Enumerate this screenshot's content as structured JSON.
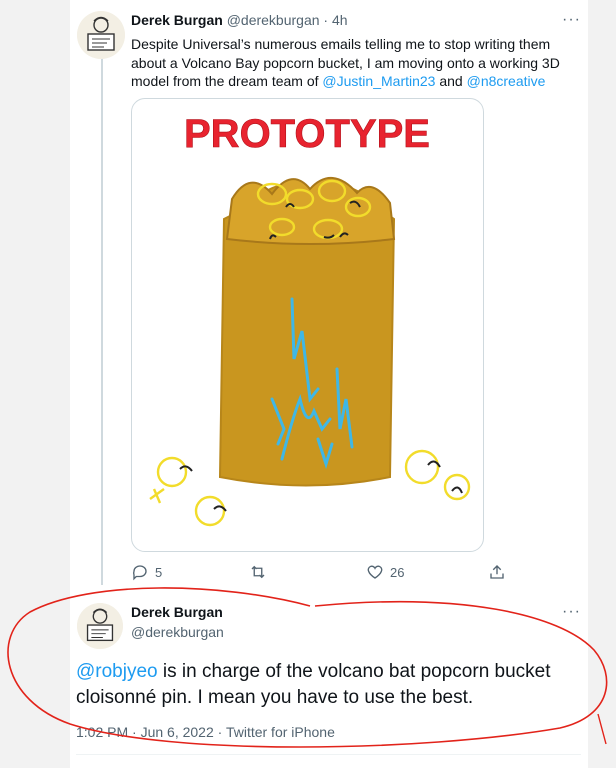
{
  "tweet1": {
    "name": "Derek Burgan",
    "handle": "@derekburgan",
    "time": "· 4h",
    "more": "···",
    "text_before": "Despite Universal’s numerous emails telling me to stop writing them about a Volcano Bay popcorn bucket, I am moving onto a working 3D model from the dream team of ",
    "mention1": "@Justin_Martin23",
    "text_and": " and ",
    "mention2": "@n8creative",
    "image": {
      "headline": "PROTOTYPE"
    },
    "actions": {
      "reply_count": "5",
      "retweet_count": "",
      "like_count": "26"
    }
  },
  "tweet2": {
    "name": "Derek Burgan",
    "handle": "@derekburgan",
    "more": "···",
    "mention": "@robjyeo",
    "text_rest": " is in charge of the volcano bat popcorn bucket cloisonné pin. I mean you have to use the best.",
    "meta": "1:02 PM · Jun 6, 2022 · Twitter for iPhone"
  },
  "avatar_sign_text": "WILL WORK FOR BOOK BOX",
  "colors": {
    "mention": "#1d9bf0",
    "secondary": "#536471",
    "annotation": "#e2231a",
    "headline": "#e8232f",
    "bucket": "#c9961f"
  }
}
